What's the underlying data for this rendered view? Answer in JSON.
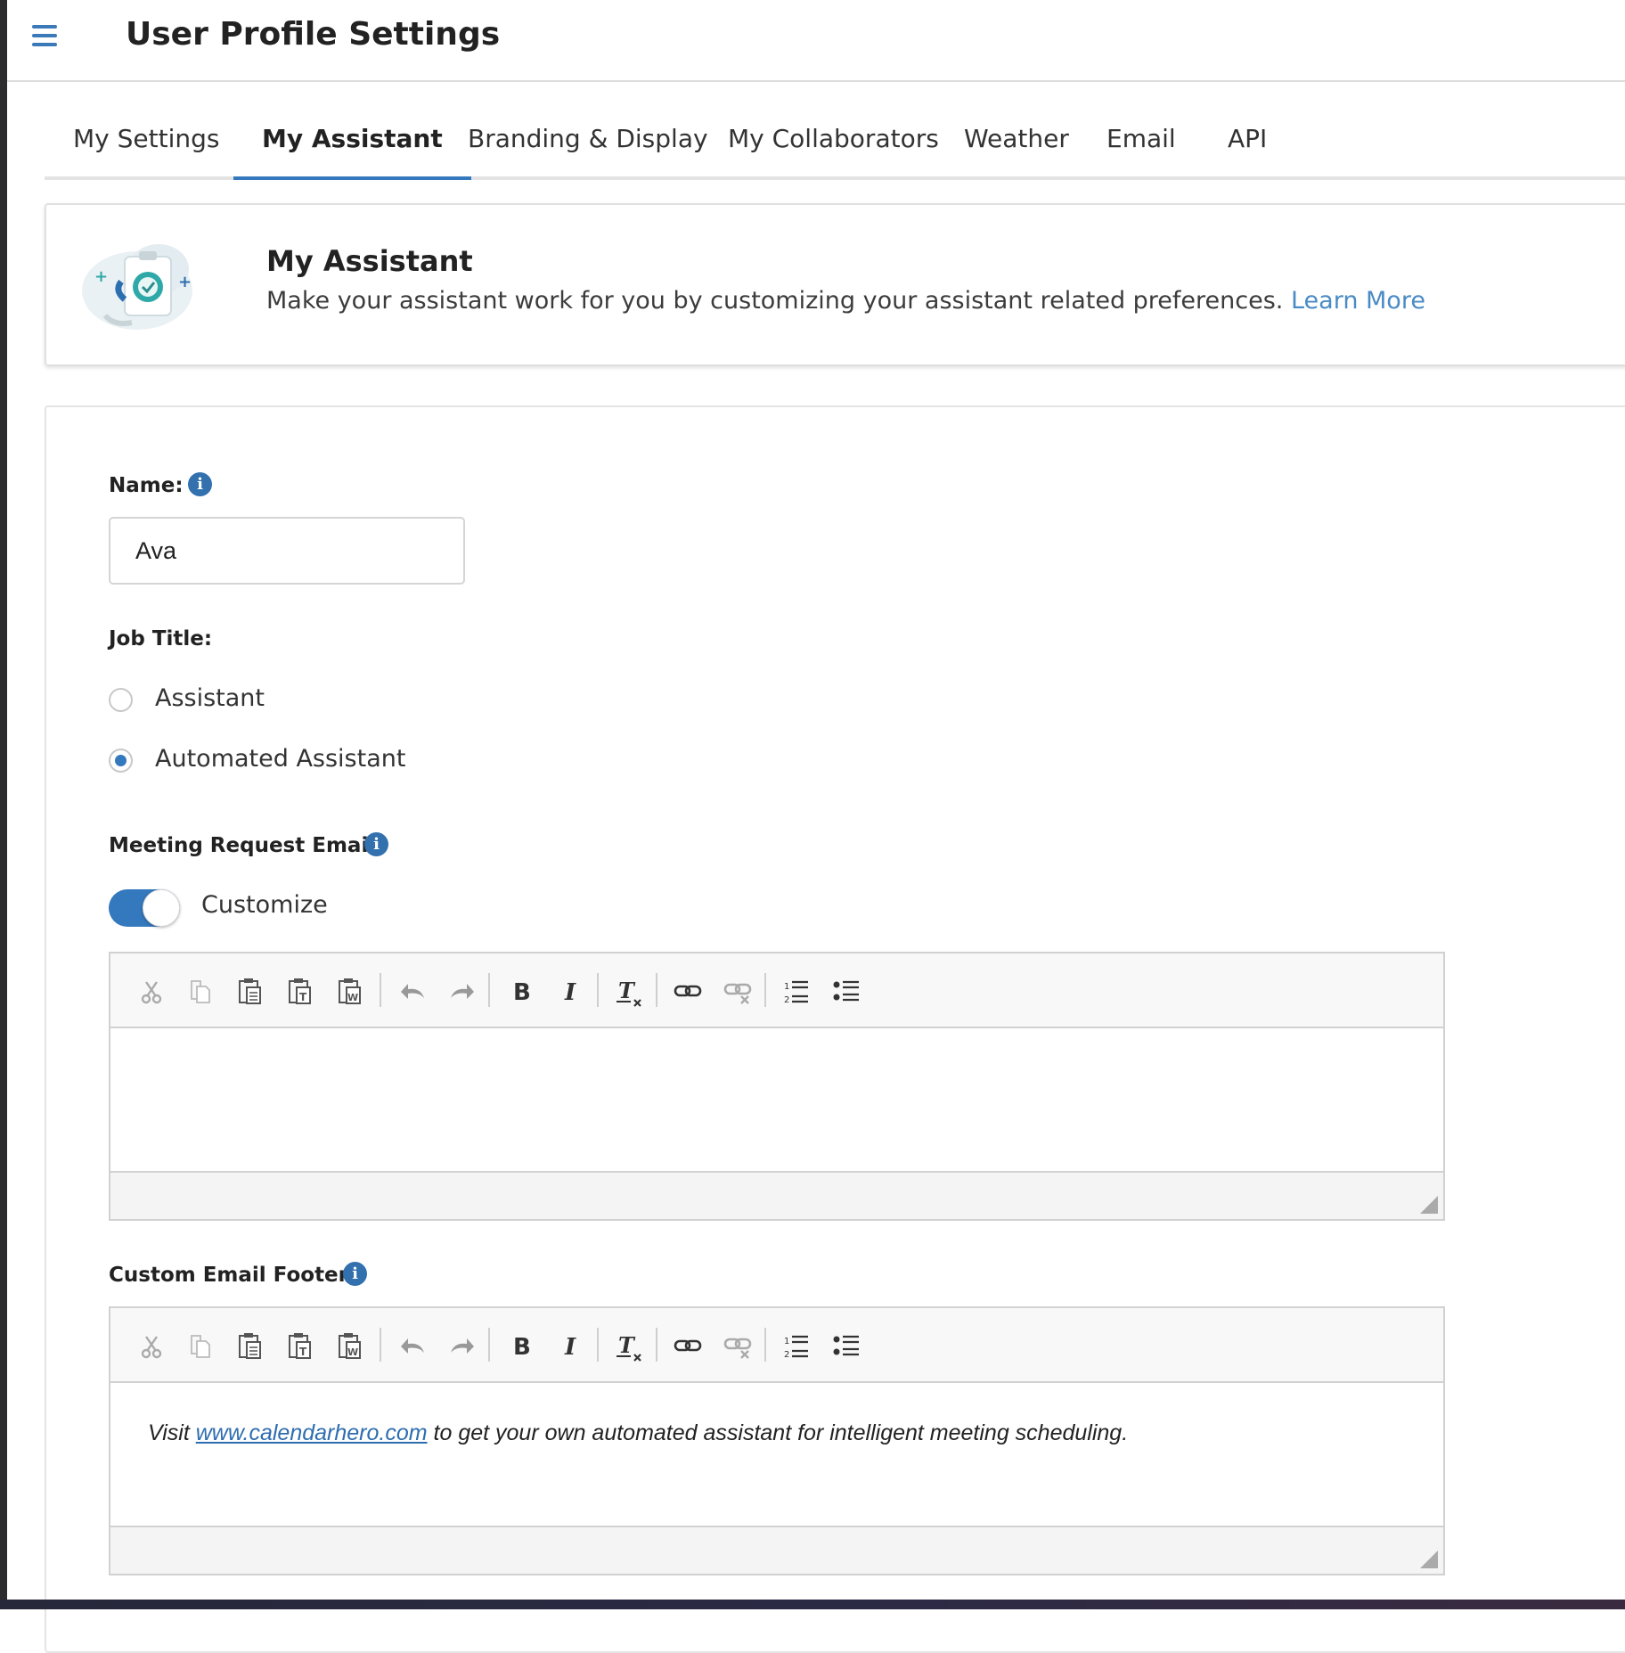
{
  "header": {
    "title": "User Profile Settings"
  },
  "tabs": [
    {
      "label": "My Settings",
      "active": false
    },
    {
      "label": "My Assistant",
      "active": true
    },
    {
      "label": "Branding & Display",
      "active": false
    },
    {
      "label": "My Collaborators",
      "active": false
    },
    {
      "label": "Weather",
      "active": false
    },
    {
      "label": "Email",
      "active": false
    },
    {
      "label": "API",
      "active": false
    }
  ],
  "info_card": {
    "title": "My Assistant",
    "description": "Make your assistant work for you by customizing your assistant related preferences.",
    "link_label": "Learn More"
  },
  "form": {
    "name_label": "Name:",
    "name_value": "Ava",
    "job_title_label": "Job Title:",
    "job_title_options": [
      {
        "label": "Assistant",
        "selected": false
      },
      {
        "label": "Automated Assistant",
        "selected": true
      }
    ],
    "meeting_email_label": "Meeting Request Email:",
    "customize_label": "Customize",
    "customize_on": true,
    "footer_label": "Custom Email Footer:",
    "footer_text_before": "Visit",
    "footer_link": "www.calendarhero.com",
    "footer_text_after": "to get your own automated assistant for intelligent meeting scheduling.",
    "meeting_email_body": ""
  },
  "toolbar_icons": [
    "cut-icon",
    "copy-icon",
    "paste-icon",
    "paste-text-icon",
    "paste-word-icon",
    "undo-icon",
    "redo-icon",
    "bold-icon",
    "italic-icon",
    "remove-format-icon",
    "link-icon",
    "unlink-icon",
    "numbered-list-icon",
    "bulleted-list-icon"
  ],
  "colors": {
    "accent": "#3478bd",
    "link": "#4a8bc6",
    "info_icon": "#3270ae"
  }
}
